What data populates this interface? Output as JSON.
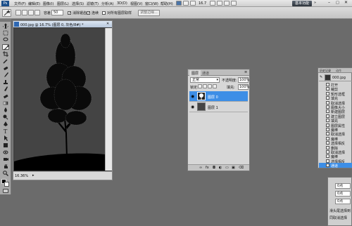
{
  "menubar": {
    "logo": "Ps",
    "items": [
      "文件(F)",
      "编辑(E)",
      "图像(I)",
      "图层(L)",
      "选择(S)",
      "滤镜(T)",
      "分析(A)",
      "3D(D)",
      "视图(V)",
      "窗口(W)",
      "帮助(H)"
    ],
    "zoom": "16.7",
    "workspace": "基本功能"
  },
  "options": {
    "tolerance_label": "容差：",
    "tolerance_value": "50",
    "antialias": "消除锯齿",
    "contiguous": "连续",
    "sample_all": "对所有图层取样",
    "refine_edge": "调整边缘..."
  },
  "document": {
    "tab_title": "000.jpg @ 16.7% (图层 0, 灰色/8#) *",
    "zoom_status": "16.36%"
  },
  "layers_panel": {
    "tabs": [
      "图层",
      "通道"
    ],
    "blend_mode": "正常",
    "opacity_label": "不透明度:",
    "opacity_value": "100%",
    "lock_label": "锁定:",
    "fill_label": "填充:",
    "fill_value": "100%",
    "layers": [
      {
        "name": "图层 0",
        "selected": true
      },
      {
        "name": "图层 1",
        "selected": false
      }
    ]
  },
  "history_panel": {
    "tabs": [
      "历史记录",
      "动作"
    ],
    "snapshot": "000.jpg",
    "steps": [
      "打开",
      "裁剪",
      "矩形选框",
      "填充",
      "取消选择",
      "图像大小",
      "新建图层",
      "建立图层",
      "填充",
      "图层属性",
      "魔棒",
      "取消选择",
      "魔棒",
      "选择相反",
      "删除",
      "取消选择",
      "魔棒",
      "选择相反",
      "通道"
    ]
  },
  "bottom_right": {
    "labels": [
      "0点",
      "0点",
      "0点"
    ],
    "text1": "滑头尾选择到",
    "text2": "同取消选择"
  },
  "colors": {
    "selected_layer": "#3d8ee6",
    "canvas_bg": "#444444"
  }
}
